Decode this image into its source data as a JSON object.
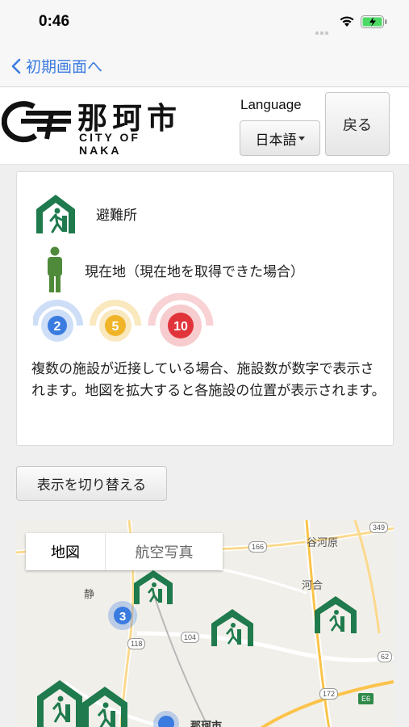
{
  "status": {
    "time": "0:46"
  },
  "nav": {
    "back_label": "初期画面へ"
  },
  "header": {
    "logo_kanji": "那珂市",
    "logo_roman": "CITY OF NAKA",
    "language_label": "Language",
    "language_value": "日本語",
    "back_button": "戻る"
  },
  "legend": {
    "shelter_label": "避難所",
    "current_location_label": "現在地（現在地を取得できた場合）",
    "clusters": [
      {
        "count": "2",
        "color": "#3a7be0"
      },
      {
        "count": "5",
        "color": "#f0b429"
      },
      {
        "count": "10",
        "color": "#e0343a"
      }
    ],
    "note": "複数の施設が近接している場合、施設数が数字で表示されます。地図を拡大すると各施設の位置が表示されます。"
  },
  "switch_button": "表示を切り替える",
  "map": {
    "tabs": [
      {
        "label": "地図",
        "active": true
      },
      {
        "label": "航空写真",
        "active": false
      }
    ],
    "place_labels": [
      "谷河原",
      "河合",
      "静",
      "那珂市"
    ],
    "route_labels": [
      "166",
      "349",
      "118",
      "104",
      "62",
      "172",
      "E6"
    ],
    "cluster_count": "3",
    "shelter_color": "#1f7a4d",
    "person_color": "#4f8a3a"
  }
}
